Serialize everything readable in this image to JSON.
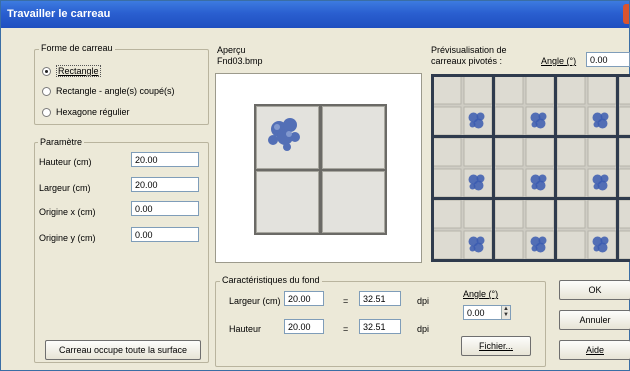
{
  "window": {
    "title": "Travailler le carreau"
  },
  "shape_group": {
    "label": "Forme de carreau",
    "options": [
      {
        "label": "Rectangle",
        "selected": true
      },
      {
        "label": "Rectangle - angle(s) coupé(s)",
        "selected": false
      },
      {
        "label": "Hexagone régulier",
        "selected": false
      }
    ]
  },
  "params_group": {
    "label": "Paramètre",
    "fields": [
      {
        "label": "Hauteur (cm)",
        "value": "20.00"
      },
      {
        "label": "Largeur (cm)",
        "value": "20.00"
      },
      {
        "label": "Origine x (cm)",
        "value": "0.00"
      },
      {
        "label": "Origine y (cm)",
        "value": "0.00"
      }
    ],
    "fill_button": "Carreau occupe toute la surface"
  },
  "preview": {
    "label": "Aperçu",
    "filename": "Fnd03.bmp"
  },
  "rotated_preview": {
    "label_line1": "Prévisualisation de",
    "label_line2": "carreaux pivotés :",
    "angle_label": "Angle (°)",
    "angle_value": "0.00"
  },
  "background_group": {
    "label": "Caractéristiques du fond",
    "width_label": "Largeur (cm)",
    "width_value": "20.00",
    "width_second": "32.51",
    "height_label": "Hauteur",
    "height_value": "20.00",
    "height_second": "32.51",
    "sep": "=",
    "unit": "dpi",
    "angle_label": "Angle (°)",
    "angle_value": "0.00",
    "file_button": "Fichier..."
  },
  "buttons": {
    "ok": "OK",
    "cancel": "Annuler",
    "help": "Aide"
  },
  "colors": {
    "title_bar": "#2a5fd0",
    "dialog_bg": "#ece9d8",
    "tile_ornament": "#3a5bb0"
  }
}
